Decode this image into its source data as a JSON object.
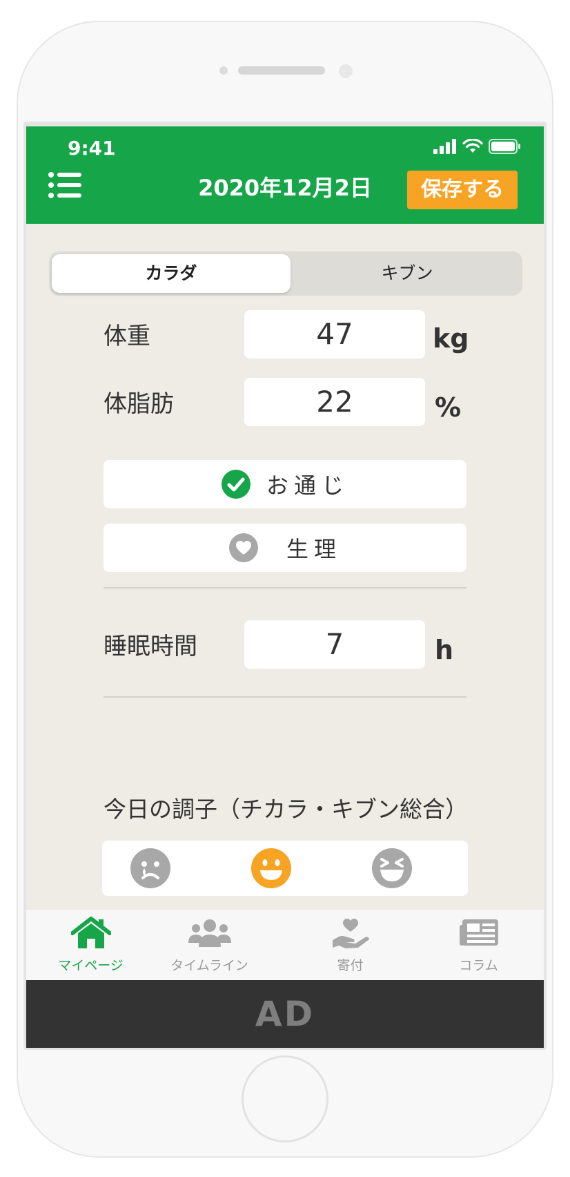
{
  "status": {
    "time": "9:41"
  },
  "header": {
    "date_title": "2020年12月2日",
    "save_label": "保存する"
  },
  "segment": {
    "tabs": [
      {
        "label": "カラダ",
        "active": true
      },
      {
        "label": "キブン",
        "active": false
      }
    ]
  },
  "fields": {
    "weight": {
      "label": "体重",
      "value": "47",
      "unit": "kg"
    },
    "body_fat": {
      "label": "体脂肪",
      "value": "22",
      "unit": "%"
    },
    "sleep": {
      "label": "睡眠時間",
      "value": "7",
      "unit": "h"
    }
  },
  "toggles": {
    "bowel": {
      "label": "お通じ",
      "checked": true
    },
    "period": {
      "label": "生理",
      "checked": false
    }
  },
  "condition": {
    "title": "今日の調子（チカラ・キブン総合）",
    "moods": [
      {
        "name": "sad",
        "selected": false
      },
      {
        "name": "happy",
        "selected": true
      },
      {
        "name": "laughing",
        "selected": false
      }
    ]
  },
  "tabbar": {
    "items": [
      {
        "label": "マイページ",
        "icon": "home-icon",
        "active": true
      },
      {
        "label": "タイムライン",
        "icon": "users-icon",
        "active": false
      },
      {
        "label": "寄付",
        "icon": "donate-icon",
        "active": false
      },
      {
        "label": "コラム",
        "icon": "newspaper-icon",
        "active": false
      }
    ]
  },
  "ad": {
    "label": "AD"
  },
  "colors": {
    "brand_green": "#17a549",
    "accent_orange": "#f7a324",
    "inactive_gray": "#a8a8a8",
    "background": "#eeece5"
  }
}
